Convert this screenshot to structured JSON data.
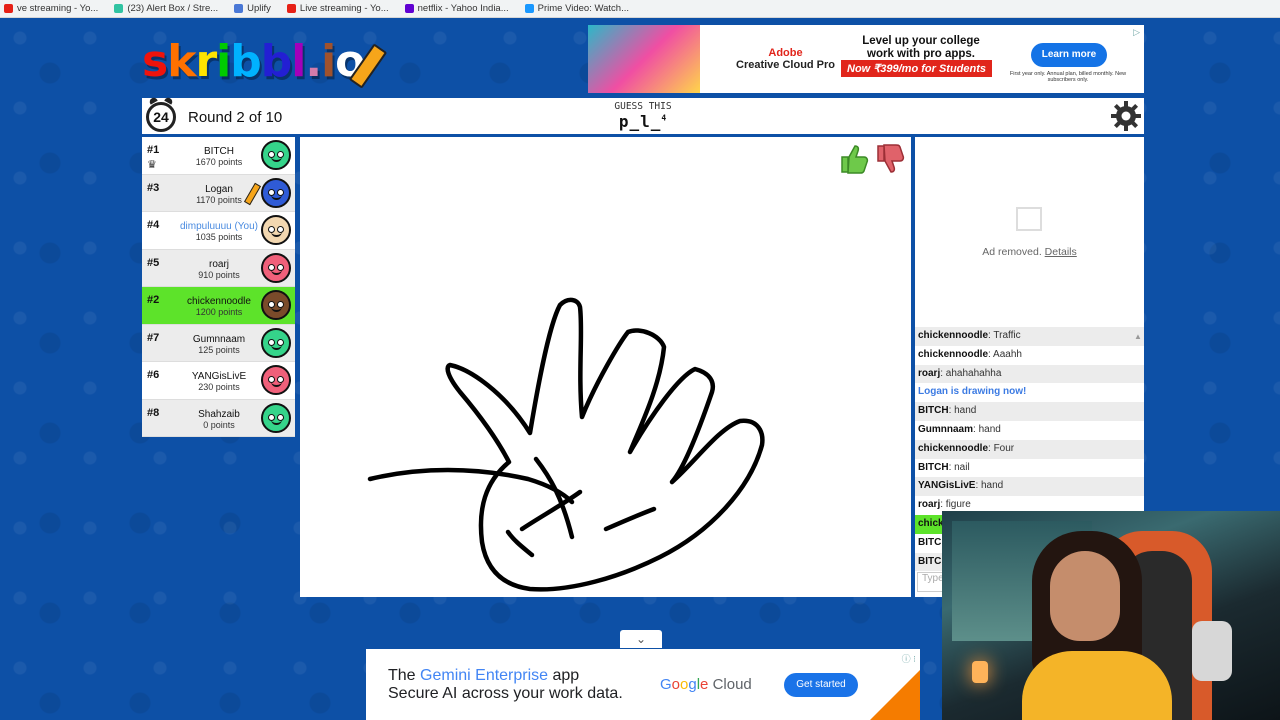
{
  "bookmarks": [
    {
      "label": "ve streaming - Yo...",
      "color": "#e62117"
    },
    {
      "label": "(23) Alert Box / Stre...",
      "color": "#31c3a2"
    },
    {
      "label": "Uplify",
      "color": "#4a78d6"
    },
    {
      "label": "Live streaming - Yo...",
      "color": "#e62117"
    },
    {
      "label": "netflix - Yahoo India...",
      "color": "#6001d2"
    },
    {
      "label": "Prime Video: Watch...",
      "color": "#1a98ff"
    }
  ],
  "logo": {
    "text": "skribbl.io"
  },
  "top_ad": {
    "brand_top": "Adobe",
    "brand_bottom": "Creative Cloud Pro",
    "headline": "Level up your college work with pro apps.",
    "offer": "Now ₹399/mo for Students",
    "button": "Learn more",
    "fine_print": "First year only. Annual plan, billed monthly. New subscribers only."
  },
  "header": {
    "timer": "24",
    "round": "Round 2 of 10",
    "guess_label": "GUESS THIS",
    "word": "p_l_",
    "word_length": "4"
  },
  "players": [
    {
      "rank": "#1",
      "name": "BITCH",
      "points": "1670 points",
      "color": "#35d48a"
    },
    {
      "rank": "#3",
      "name": "Logan",
      "points": "1170 points",
      "color": "#2f5bd6"
    },
    {
      "rank": "#4",
      "name": "dimpuluuuu (You)",
      "points": "1035 points",
      "color": "#f2d7b0"
    },
    {
      "rank": "#5",
      "name": "roarj",
      "points": "910 points",
      "color": "#f0607a"
    },
    {
      "rank": "#2",
      "name": "chickennoodle",
      "points": "1200 points",
      "color": "#7a4b2a"
    },
    {
      "rank": "#7",
      "name": "Gumnnaam",
      "points": "125 points",
      "color": "#35d48a"
    },
    {
      "rank": "#6",
      "name": "YANGisLivE",
      "points": "230 points",
      "color": "#f0607a"
    },
    {
      "rank": "#8",
      "name": "Shahzaib",
      "points": "0 points",
      "color": "#35d48a"
    }
  ],
  "side_ad": {
    "text": "Ad removed.",
    "link": "Details"
  },
  "chat": [
    {
      "user": "chickennoodle",
      "text": "Traffic"
    },
    {
      "user": "chickennoodle",
      "text": "Aaahh"
    },
    {
      "user": "roarj",
      "text": "ahahahahha"
    },
    {
      "system": "Logan is drawing now!"
    },
    {
      "user": "BITCH",
      "text": "hand"
    },
    {
      "user": "Gumnnaam",
      "text": "hand"
    },
    {
      "user": "chickennoodle",
      "text": "Four"
    },
    {
      "user": "BITCH",
      "text": "nail"
    },
    {
      "user": "YANGisLivE",
      "text": "hand"
    },
    {
      "user": "roarj",
      "text": "figure"
    },
    {
      "partial": "chick"
    },
    {
      "partial": "BITC"
    },
    {
      "partial": "BITC"
    }
  ],
  "chat_input": {
    "placeholder": "Type"
  },
  "bottom_ad": {
    "line1_pre": "The ",
    "line1_hl": "Gemini Enterprise",
    "line1_post": " app",
    "line2": "Secure AI across your work data.",
    "brand_google": [
      "G",
      "o",
      "o",
      "g",
      "l",
      "e"
    ],
    "brand_cloud": "Cloud",
    "button": "Get started"
  }
}
